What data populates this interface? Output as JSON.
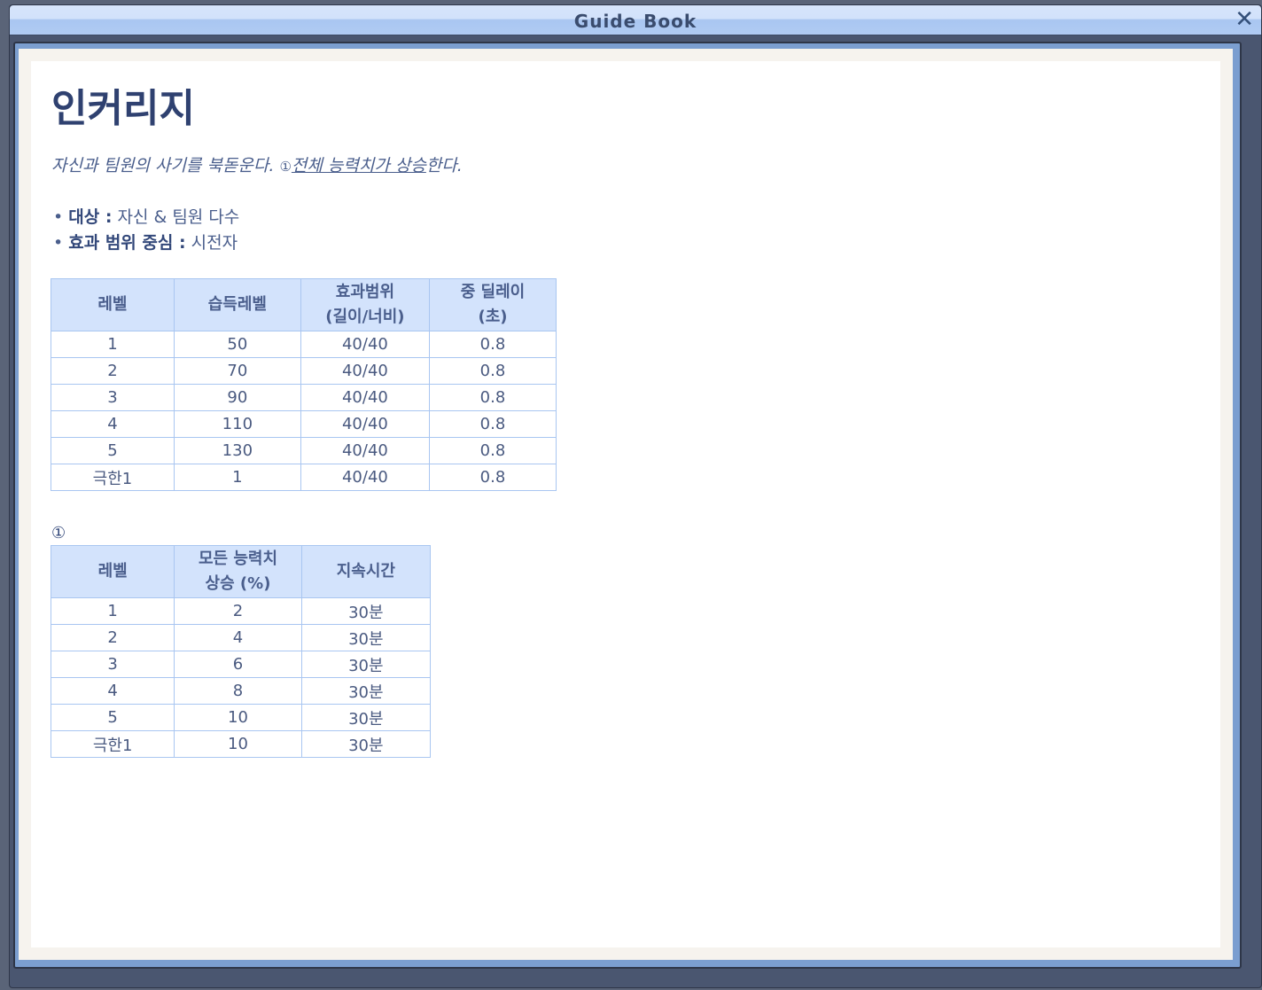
{
  "window": {
    "title": "Guide Book",
    "close_label": "✕"
  },
  "skill": {
    "name": "인커리지",
    "desc_plain": "자신과 팀원의 사기를 북돋운다. ",
    "desc_mark": "①",
    "desc_link": "전체 능력치가 상승",
    "desc_end": "한다.",
    "bullets": [
      {
        "label": "대상 :",
        "value": " 자신 & 팀원 다수"
      },
      {
        "label": "효과 범위 중심 :",
        "value": " 시전자"
      }
    ]
  },
  "table1": {
    "headers": [
      "레벨",
      "습득레벨",
      "효과범위\n(길이/너비)",
      "중 딜레이\n(초)"
    ],
    "rows": [
      [
        "1",
        "50",
        "40/40",
        "0.8"
      ],
      [
        "2",
        "70",
        "40/40",
        "0.8"
      ],
      [
        "3",
        "90",
        "40/40",
        "0.8"
      ],
      [
        "4",
        "110",
        "40/40",
        "0.8"
      ],
      [
        "5",
        "130",
        "40/40",
        "0.8"
      ],
      [
        "극한1",
        "1",
        "40/40",
        "0.8"
      ]
    ]
  },
  "footnote_mark": "①",
  "table2": {
    "headers": [
      "레벨",
      "모든 능력치\n상승 (%)",
      "지속시간"
    ],
    "rows": [
      [
        "1",
        "2",
        "30분"
      ],
      [
        "2",
        "4",
        "30분"
      ],
      [
        "3",
        "6",
        "30분"
      ],
      [
        "4",
        "8",
        "30분"
      ],
      [
        "5",
        "10",
        "30분"
      ],
      [
        "극한1",
        "10",
        "30분"
      ]
    ]
  }
}
